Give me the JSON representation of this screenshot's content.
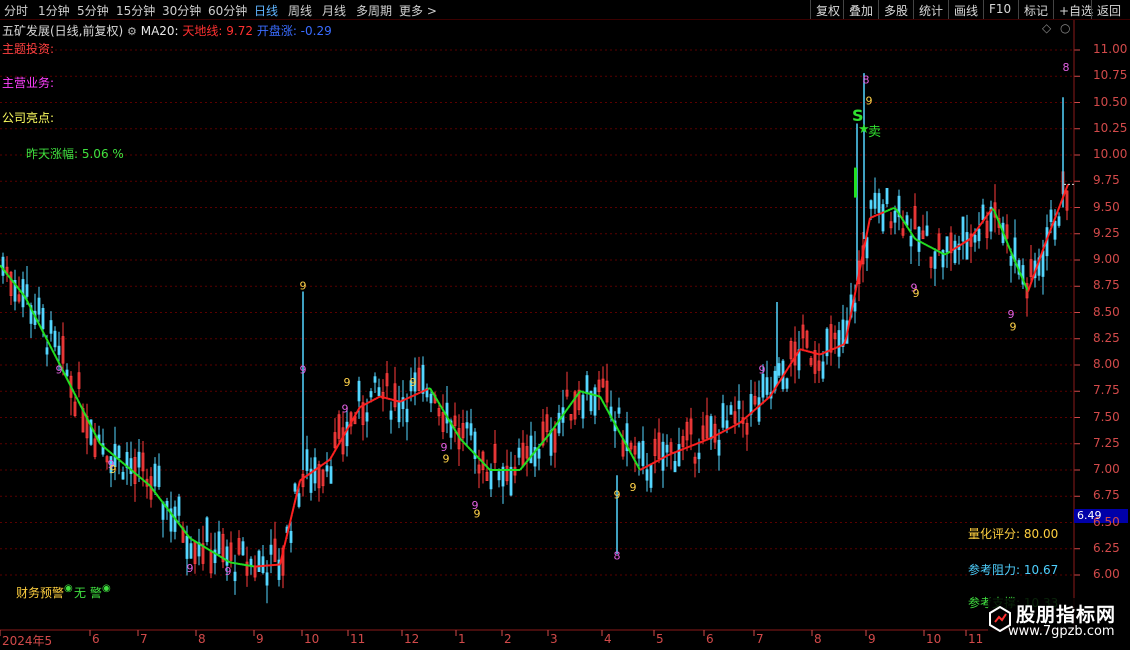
{
  "toolbar": {
    "left": [
      {
        "label": "分时",
        "active": false
      },
      {
        "label": "1分钟",
        "active": false
      },
      {
        "label": "5分钟",
        "active": false
      },
      {
        "label": "15分钟",
        "active": false
      },
      {
        "label": "30分钟",
        "active": false
      },
      {
        "label": "60分钟",
        "active": false
      },
      {
        "label": "日线",
        "active": true
      },
      {
        "label": "周线",
        "active": false
      },
      {
        "label": "月线",
        "active": false
      },
      {
        "label": "多周期",
        "active": false
      },
      {
        "label": "更多 >",
        "active": false
      }
    ],
    "right": [
      "复权",
      "叠加",
      "多股",
      "统计",
      "画线",
      "F10",
      "标记",
      "+自选",
      "返回"
    ]
  },
  "header": {
    "stock_title": "五矿发展(日线,前复权)",
    "ma_label": "MA20:",
    "tiandi_label": "天地线: 9.72",
    "kaipan_label": "开盘涨: -0.29"
  },
  "side_labels": {
    "theme_invest": "主题投资:",
    "main_business": "主营业务:",
    "highlights": "公司亮点:",
    "yesterday_change": "昨天涨幅: 5.06 %",
    "financial_warning": "财务预警",
    "no_warning": "无 警"
  },
  "signals": {
    "sell_s": "S",
    "sell_text": "卖"
  },
  "current_price_tag": "6.49",
  "scores": {
    "quant": "量化评分: 80.00",
    "resistance": "参考阻力: 10.67",
    "support": "参考支撑: 10.33"
  },
  "watermark": {
    "title": "股朋指标网",
    "url": "www.7gpzb.com"
  },
  "colors": {
    "up": "#ff3c3c",
    "down": "#54d6ff",
    "ma_up": "#ff2020",
    "ma_down": "#22e022",
    "grid": "#5a0000",
    "axis_text": "#d24a4a"
  },
  "chart_data": {
    "type": "candlestick",
    "y_ticks": [
      "11.00",
      "10.75",
      "10.50",
      "10.25",
      "10.00",
      "9.75",
      "9.50",
      "9.25",
      "9.00",
      "8.75",
      "8.50",
      "8.25",
      "8.00",
      "7.75",
      "7.50",
      "7.25",
      "7.00",
      "6.75",
      "6.50",
      "6.25",
      "6.00"
    ],
    "x_ticks": [
      "2024年5",
      "6",
      "7",
      "8",
      "9",
      "10",
      "11",
      "12",
      "1",
      "2",
      "3",
      "4",
      "5",
      "6",
      "7",
      "8",
      "9",
      "10",
      "11"
    ],
    "ma_anchors": [
      [
        0,
        8.95
      ],
      [
        25,
        8.65
      ],
      [
        60,
        8.0
      ],
      [
        100,
        7.25
      ],
      [
        150,
        6.85
      ],
      [
        190,
        6.35
      ],
      [
        230,
        6.12
      ],
      [
        255,
        6.08
      ],
      [
        280,
        6.1
      ],
      [
        300,
        6.9
      ],
      [
        330,
        7.1
      ],
      [
        360,
        7.6
      ],
      [
        380,
        7.7
      ],
      [
        400,
        7.65
      ],
      [
        430,
        7.78
      ],
      [
        460,
        7.3
      ],
      [
        490,
        7.0
      ],
      [
        520,
        7.0
      ],
      [
        550,
        7.35
      ],
      [
        580,
        7.75
      ],
      [
        600,
        7.7
      ],
      [
        620,
        7.35
      ],
      [
        640,
        7.0
      ],
      [
        670,
        7.15
      ],
      [
        710,
        7.3
      ],
      [
        740,
        7.45
      ],
      [
        770,
        7.7
      ],
      [
        800,
        8.15
      ],
      [
        820,
        8.1
      ],
      [
        845,
        8.2
      ],
      [
        870,
        9.4
      ],
      [
        895,
        9.5
      ],
      [
        915,
        9.2
      ],
      [
        945,
        9.05
      ],
      [
        970,
        9.2
      ],
      [
        993,
        9.5
      ],
      [
        1010,
        9.1
      ],
      [
        1028,
        8.7
      ],
      [
        1045,
        9.15
      ],
      [
        1068,
        9.72
      ]
    ],
    "ma_green_segments": [
      [
        0,
        255
      ],
      [
        430,
        640
      ],
      [
        885,
        950
      ],
      [
        993,
        1028
      ]
    ],
    "nine_marks": [
      {
        "x": 59,
        "price": 7.92,
        "text": "9",
        "color": "#e060e0"
      },
      {
        "x": 111,
        "price": 7.02,
        "text": "9",
        "color": "#e060e0"
      },
      {
        "x": 113,
        "price": 6.97,
        "text": "9",
        "color": "#ffd24a"
      },
      {
        "x": 190,
        "price": 6.03,
        "text": "9",
        "color": "#e060e0"
      },
      {
        "x": 228,
        "price": 6.0,
        "text": "9",
        "color": "#e060e0"
      },
      {
        "x": 303,
        "price": 8.72,
        "text": "9",
        "color": "#ffd24a"
      },
      {
        "x": 303,
        "price": 7.92,
        "text": "9",
        "color": "#e060e0"
      },
      {
        "x": 345,
        "price": 7.55,
        "text": "9",
        "color": "#e060e0"
      },
      {
        "x": 347,
        "price": 7.8,
        "text": "9",
        "color": "#ffd24a"
      },
      {
        "x": 413,
        "price": 7.8,
        "text": "9",
        "color": "#ffd24a"
      },
      {
        "x": 444,
        "price": 7.18,
        "text": "9",
        "color": "#e060e0"
      },
      {
        "x": 446,
        "price": 7.07,
        "text": "9",
        "color": "#ffd24a"
      },
      {
        "x": 475,
        "price": 6.63,
        "text": "9",
        "color": "#e060e0"
      },
      {
        "x": 477,
        "price": 6.55,
        "text": "9",
        "color": "#ffd24a"
      },
      {
        "x": 617,
        "price": 6.73,
        "text": "9",
        "color": "#ffd24a"
      },
      {
        "x": 633,
        "price": 6.8,
        "text": "9",
        "color": "#ffd24a"
      },
      {
        "x": 617,
        "price": 6.15,
        "text": "8",
        "color": "#e060e0"
      },
      {
        "x": 762,
        "price": 7.92,
        "text": "9",
        "color": "#e060e0"
      },
      {
        "x": 866,
        "price": 10.68,
        "text": "8",
        "color": "#e060e0"
      },
      {
        "x": 869,
        "price": 10.48,
        "text": "9",
        "color": "#ffd24a"
      },
      {
        "x": 914,
        "price": 8.7,
        "text": "9",
        "color": "#e060e0"
      },
      {
        "x": 916,
        "price": 8.65,
        "text": "9",
        "color": "#ffd24a"
      },
      {
        "x": 1011,
        "price": 8.45,
        "text": "9",
        "color": "#e060e0"
      },
      {
        "x": 1013,
        "price": 8.33,
        "text": "9",
        "color": "#ffd24a"
      },
      {
        "x": 1066,
        "price": 10.8,
        "text": "8",
        "color": "#e060e0"
      }
    ]
  }
}
